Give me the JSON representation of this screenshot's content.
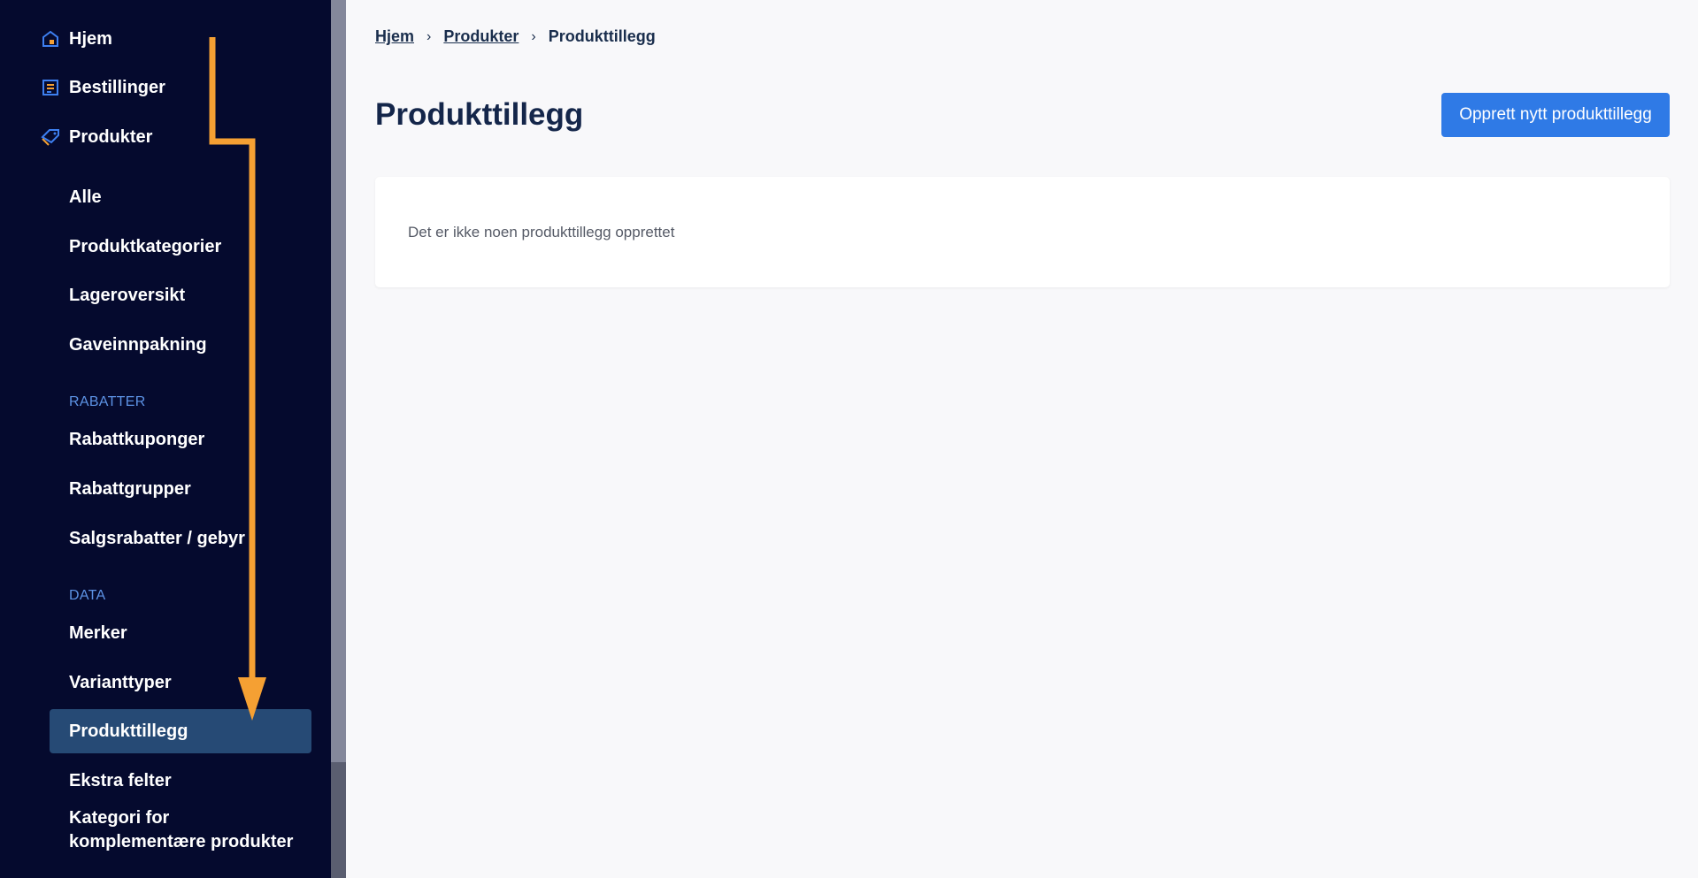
{
  "sidebar": {
    "top_items": [
      {
        "label": "Hjem",
        "icon": "home-icon"
      },
      {
        "label": "Bestillinger",
        "icon": "orders-icon"
      },
      {
        "label": "Produkter",
        "icon": "tag-icon"
      }
    ],
    "products_items": [
      "Alle",
      "Produktkategorier",
      "Lageroversikt",
      "Gaveinnpakning"
    ],
    "discounts_section": "RABATTER",
    "discounts_items": [
      "Rabattkuponger",
      "Rabattgrupper",
      "Salgsrabatter / gebyr"
    ],
    "data_section": "DATA",
    "data_items": [
      "Merker",
      "Varianttyper",
      "Produkttillegg",
      "Ekstra felter"
    ],
    "multiline_item": {
      "line1": "Kategori for",
      "line2": "komplementære produkter"
    },
    "active_item": "Produkttillegg"
  },
  "breadcrumb": {
    "items": [
      "Hjem",
      "Produkter"
    ],
    "current": "Produkttillegg"
  },
  "page": {
    "title": "Produkttillegg",
    "create_button": "Opprett nytt produkttillegg",
    "empty_message": "Det er ikke noen produkttillegg opprettet"
  },
  "colors": {
    "sidebar_bg": "#050a2e",
    "active_bg": "#264a75",
    "accent_blue": "#2f7ae6",
    "section_label": "#5d93e6",
    "annotation_arrow": "#f5a033"
  }
}
